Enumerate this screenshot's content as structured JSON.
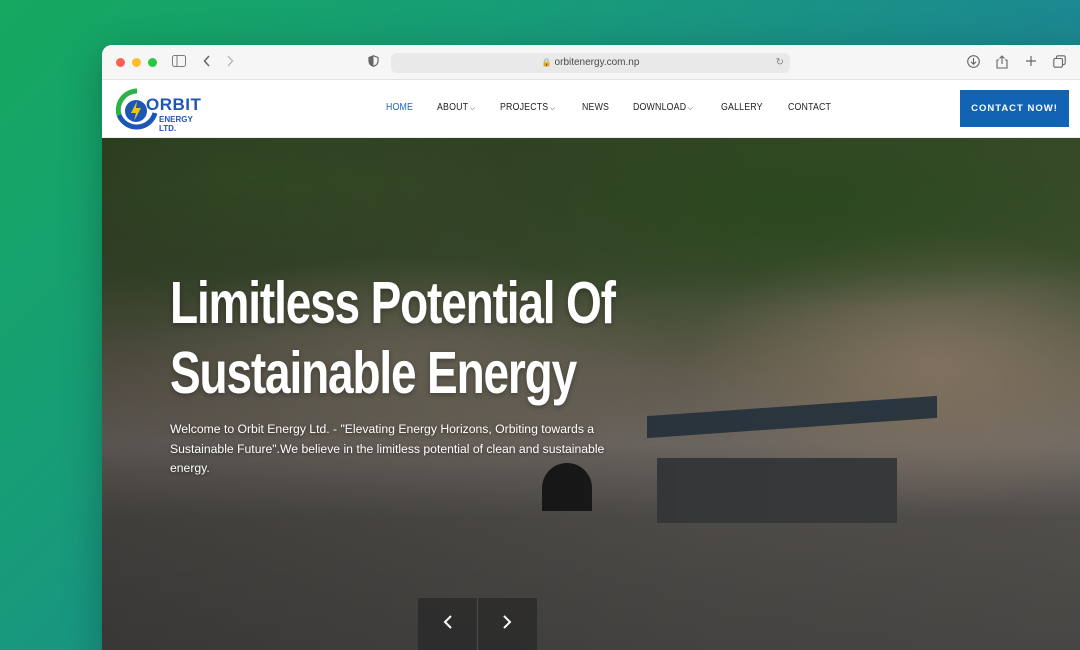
{
  "browser": {
    "url": "orbitenergy.com.np",
    "icons": {
      "sidebar": "sidebar-icon",
      "back": "chevron-left-icon",
      "forward": "chevron-right-icon",
      "privacy": "shield-icon",
      "lock": "lock-icon",
      "reload": "reload-icon",
      "download": "download-icon",
      "share": "share-icon",
      "new_tab": "plus-icon",
      "tabs": "tabs-icon"
    }
  },
  "site": {
    "logo": {
      "line1": "ORBIT",
      "line2": "ENERGY LTD."
    },
    "nav": [
      {
        "label": "HOME",
        "active": true,
        "dropdown": false
      },
      {
        "label": "ABOUT",
        "active": false,
        "dropdown": true
      },
      {
        "label": "PROJECTS",
        "active": false,
        "dropdown": true
      },
      {
        "label": "NEWS",
        "active": false,
        "dropdown": false
      },
      {
        "label": "DOWNLOAD",
        "active": false,
        "dropdown": true
      },
      {
        "label": "GALLERY",
        "active": false,
        "dropdown": false
      },
      {
        "label": "CONTACT",
        "active": false,
        "dropdown": false
      }
    ],
    "cta_label": "CONTACT NOW!"
  },
  "hero": {
    "title_line1": "Limitless Potential Of",
    "title_line2": "Sustainable Energy",
    "description": "Welcome to Orbit Energy Ltd. - \"Elevating Energy Horizons, Orbiting towards a Sustainable Future\".We believe in the limitless potential of clean and sustainable energy.",
    "prev_icon": "chevron-left-icon",
    "next_icon": "chevron-right-icon"
  },
  "colors": {
    "accent": "#1164b4",
    "nav_active": "#1c68b3",
    "logo_blue": "#1e56b8",
    "logo_green": "#2fb14a",
    "logo_yellow": "#f2c318"
  }
}
